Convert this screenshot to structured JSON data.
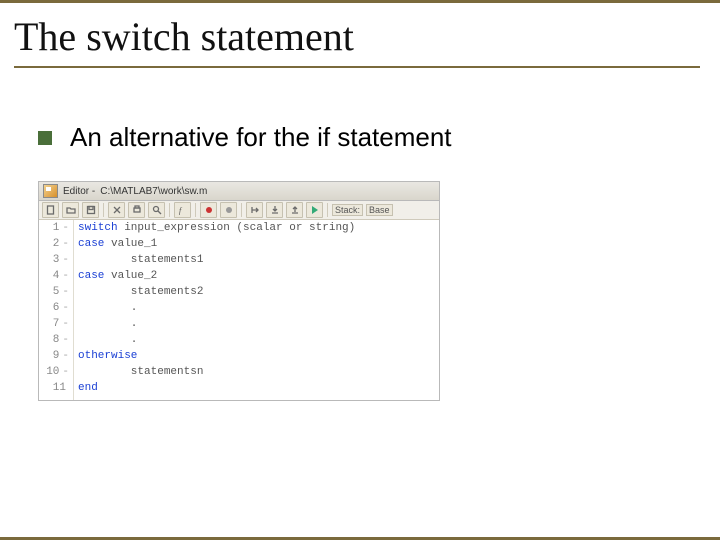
{
  "title": "The switch statement",
  "bullet": "An alternative for the if statement",
  "editor": {
    "title_prefix": "Editor - ",
    "path": "C:\\MATLAB7\\work\\sw.m",
    "stack_label": "Stack:",
    "base_label": "Base",
    "gutter": [
      "1",
      "2",
      "3",
      "4",
      "5",
      "6",
      "7",
      "8",
      "9",
      "10",
      "11"
    ],
    "dash": [
      "-",
      "-",
      "-",
      "-",
      "-",
      "-",
      "-",
      "-",
      "-",
      "-",
      ""
    ],
    "lines": {
      "l1_kw": "switch",
      "l1_rest": " input_expression (scalar or string)",
      "l2_kw": "case",
      "l2_rest": " value_1",
      "l3": "        statements1",
      "l4_kw": "case",
      "l4_rest": " value_2",
      "l5": "        statements2",
      "l6": "        .",
      "l7": "        .",
      "l8": "        .",
      "l9_kw": "otherwise",
      "l10": "        statementsn",
      "l11_kw": "end"
    }
  }
}
